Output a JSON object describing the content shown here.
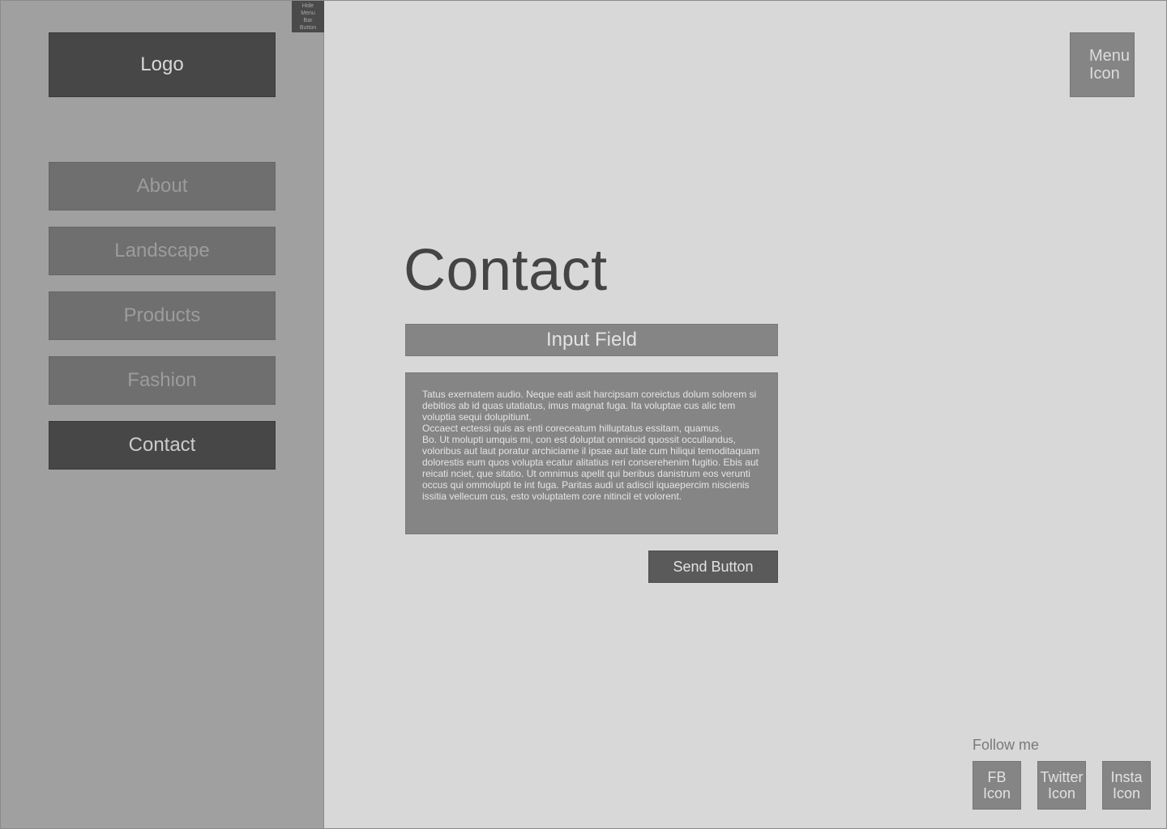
{
  "sidebar": {
    "hide_button_lines": [
      "Hide",
      "Menu",
      "Bar",
      "Button"
    ],
    "logo": "Logo",
    "nav": [
      {
        "label": "About"
      },
      {
        "label": "Landscape"
      },
      {
        "label": "Products"
      },
      {
        "label": "Fashion"
      },
      {
        "label": "Contact",
        "active": true
      }
    ]
  },
  "header": {
    "menu_icon_lines": [
      "Menu",
      "Icon"
    ]
  },
  "main": {
    "title": "Contact",
    "input_field": "Input Field",
    "message_paragraphs": [
      "Tatus exernatem audio. Neque eati asit harcipsam coreictus dolum solorem si debitios ab id quas utatiatus, imus magnat fuga. Ita voluptae cus alic tem voluptia sequi dolupitiunt.",
      "Occaect ectessi quis as enti coreceatum hilluptatus essitam, quamus.",
      "Bo. Ut molupti umquis mi, con est doluptat omniscid quossit occullandus, voloribus aut laut poratur archiciame il ipsae aut late cum hiliqui temoditaquam dolorestis eum quos volupta ecatur alitatius reri conserehenim fugitio. Ebis aut reicati nciet, que sitatio. Ut omnimus apelit qui beribus danistrum eos verunti occus qui ommolupti te int fuga. Paritas audi ut adiscil iquaepercim niscienis issitia vellecum cus, esto voluptatem core nitincil et volorent."
    ],
    "send_button": "Send Button"
  },
  "footer": {
    "follow_label": "Follow me",
    "social": [
      {
        "lines": [
          "FB",
          "Icon"
        ]
      },
      {
        "lines": [
          "Twitter",
          "Icon"
        ]
      },
      {
        "lines": [
          "Insta",
          "Icon"
        ]
      }
    ]
  }
}
